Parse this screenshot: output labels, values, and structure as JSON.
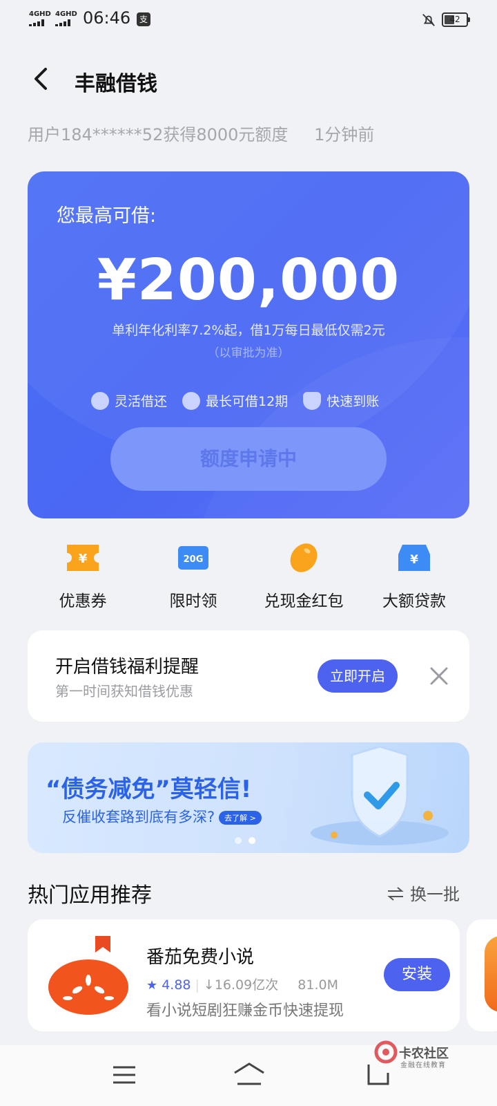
{
  "status_bar": {
    "net1": "4GHD",
    "net2": "4GHD",
    "time": "06:46",
    "battery": "42"
  },
  "header": {
    "title": "丰融借钱"
  },
  "ticker": {
    "message": "用户184******52获得8000元额度",
    "when": "1分钟前"
  },
  "hero": {
    "label": "您最高可借:",
    "amount": "¥200,000",
    "rate_text": "单利年化利率7.2%起，借1万每日最低仅需2元",
    "note": "（以审批为准）",
    "features": [
      "灵活借还",
      "最长可借12期",
      "快速到账"
    ],
    "apply_label": "额度申请中"
  },
  "quick_actions": [
    {
      "label": "优惠券",
      "icon": "coupon-icon"
    },
    {
      "label": "限时领",
      "icon": "20g-icon"
    },
    {
      "label": "兑现金红包",
      "icon": "bean-icon"
    },
    {
      "label": "大额贷款",
      "icon": "loan-icon"
    }
  ],
  "reminder": {
    "title": "开启借钱福利提醒",
    "subtitle": "第一时间获知借钱优惠",
    "button": "立即开启"
  },
  "banner": {
    "title": "“债务减免”莫轻信!",
    "subtitle": "反催收套路到底有多深?",
    "pill": "去了解 >"
  },
  "recommend": {
    "title": "热门应用推荐",
    "refresh": "换一批",
    "app": {
      "name": "番茄免费小说",
      "rating": "4.88",
      "downloads": "↓16.09亿次",
      "size": "81.0M",
      "desc": "看小说短剧狂赚金币快速提现",
      "install": "安装"
    }
  },
  "watermark": {
    "name": "卡农社区",
    "sub": "金融在线教育"
  },
  "colors": {
    "accent": "#4d63ef",
    "hero_bg": "#4a68f4",
    "page_bg": "#f1f2f5"
  }
}
